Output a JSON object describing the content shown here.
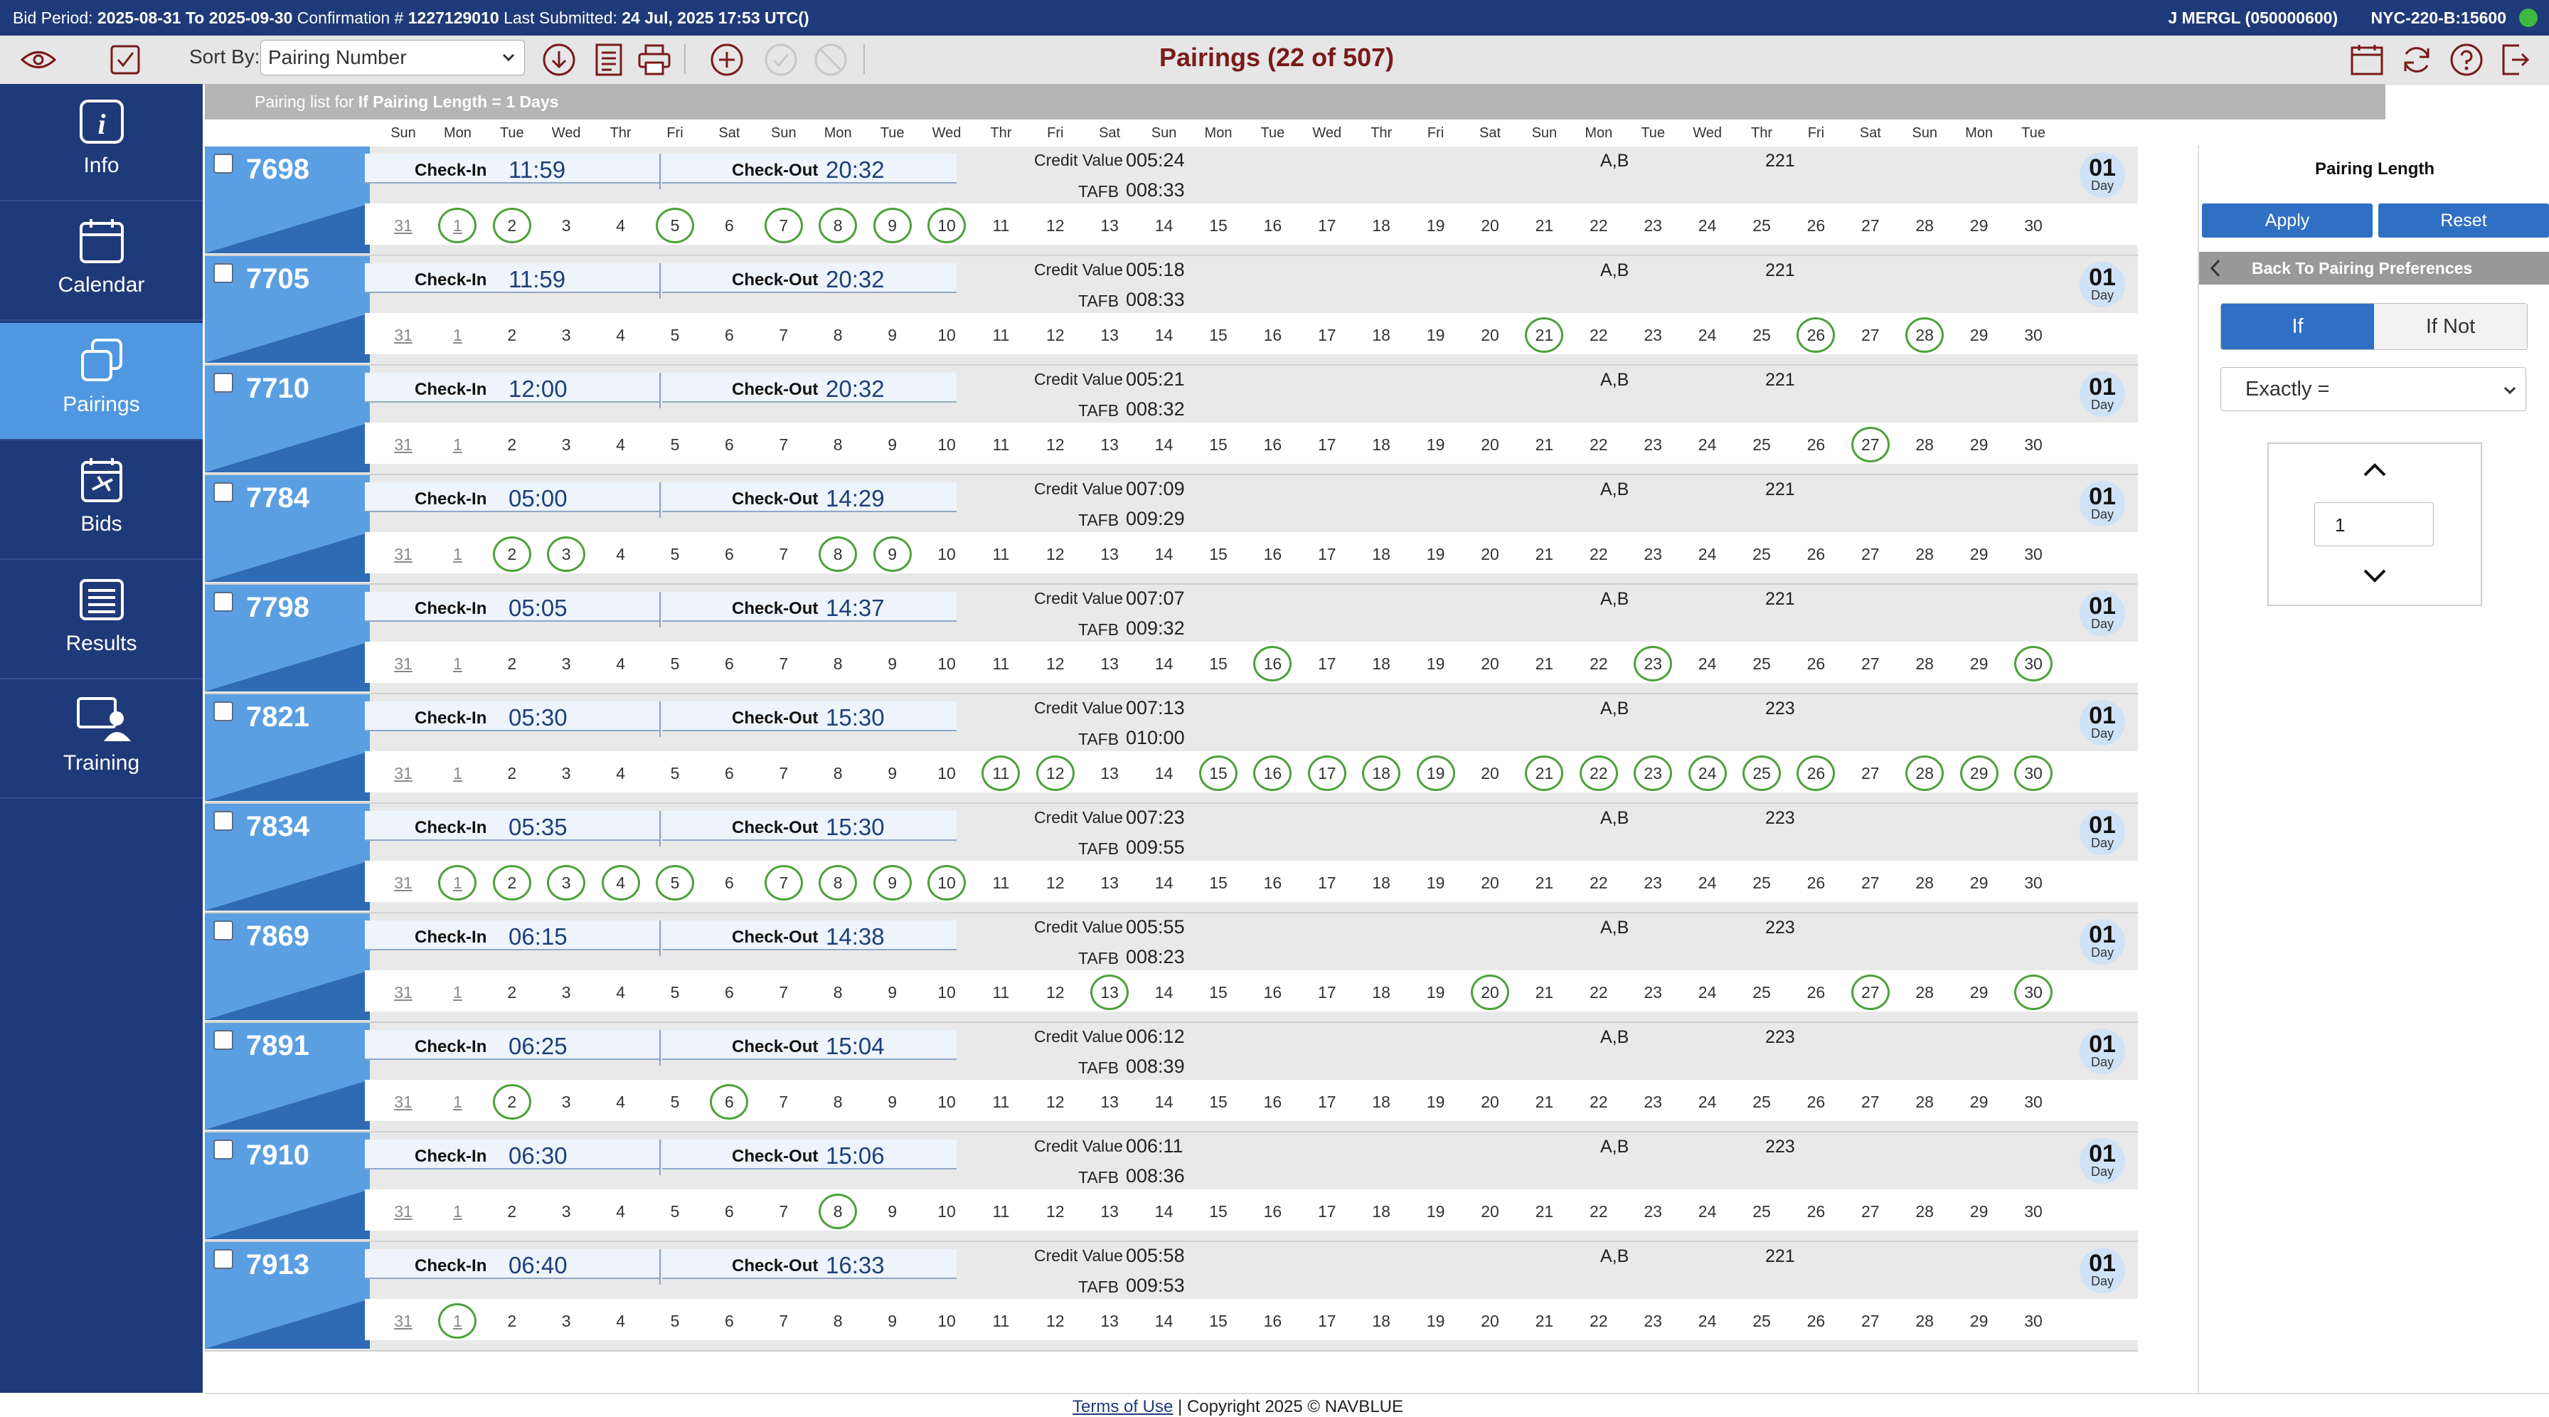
{
  "topbar": {
    "bid_period_label": "Bid Period:",
    "bid_period_value": "2025-08-31 To 2025-09-30",
    "confirmation_label": "Confirmation #",
    "confirmation_value": "1227129010",
    "last_submitted_label": "Last Submitted:",
    "last_submitted_value": "24 Jul, 2025 17:53 UTC()",
    "user": "J MERGL (050000600)",
    "bid_code": "NYC-220-B:15600",
    "status_color": "#3fb93f"
  },
  "toolbar": {
    "sort_by_label": "Sort By:",
    "sort_by_value": "Pairing Number",
    "title": "Pairings (22 of 507)",
    "left_icons": [
      "eye-icon",
      "checkbox-icon",
      "download-icon",
      "report-icon",
      "print-icon",
      "add-icon",
      "check-icon",
      "cancel-icon"
    ],
    "right_icons": [
      "calendar-icon",
      "refresh-icon",
      "help-icon",
      "logout-icon"
    ]
  },
  "sidebar": {
    "items": [
      {
        "label": "Info",
        "icon": "info-icon",
        "active": false
      },
      {
        "label": "Calendar",
        "icon": "calendar-icon",
        "active": false
      },
      {
        "label": "Pairings",
        "icon": "pairings-icon",
        "active": true
      },
      {
        "label": "Bids",
        "icon": "bids-icon",
        "active": false
      },
      {
        "label": "Results",
        "icon": "results-icon",
        "active": false
      },
      {
        "label": "Training",
        "icon": "training-icon",
        "active": false
      }
    ]
  },
  "list": {
    "header_prefix": "Pairing list for",
    "header_filter": "If Pairing Length = 1 Days",
    "day_names": [
      "Sun",
      "Mon",
      "Tue",
      "Wed",
      "Thr",
      "Fri",
      "Sat",
      "Sun",
      "Mon",
      "Tue",
      "Wed",
      "Thr",
      "Fri",
      "Sat",
      "Sun",
      "Mon",
      "Tue",
      "Wed",
      "Thr",
      "Fri",
      "Sat",
      "Sun",
      "Mon",
      "Tue",
      "Wed",
      "Thr",
      "Fri",
      "Sat",
      "Sun",
      "Mon",
      "Tue"
    ],
    "dates": [
      "31",
      "1",
      "2",
      "3",
      "4",
      "5",
      "6",
      "7",
      "8",
      "9",
      "10",
      "11",
      "12",
      "13",
      "14",
      "15",
      "16",
      "17",
      "18",
      "19",
      "20",
      "21",
      "22",
      "23",
      "24",
      "25",
      "26",
      "27",
      "28",
      "29",
      "30"
    ],
    "checkin_label": "Check-In",
    "checkout_label": "Check-Out",
    "credit_label": "Credit Value",
    "tafb_label": "TAFB",
    "day_badge_label": "Day",
    "pairings": [
      {
        "number": "7698",
        "checkin": "11:59",
        "checkout": "20:32",
        "credit": "005:24",
        "tafb": "008:33",
        "base": "A,B",
        "equipment": "221",
        "days": "01",
        "active_days": [
          1,
          2,
          5,
          7,
          8,
          9,
          10
        ]
      },
      {
        "number": "7705",
        "checkin": "11:59",
        "checkout": "20:32",
        "credit": "005:18",
        "tafb": "008:33",
        "base": "A,B",
        "equipment": "221",
        "days": "01",
        "active_days": [
          21,
          26,
          28
        ]
      },
      {
        "number": "7710",
        "checkin": "12:00",
        "checkout": "20:32",
        "credit": "005:21",
        "tafb": "008:32",
        "base": "A,B",
        "equipment": "221",
        "days": "01",
        "active_days": [
          27
        ]
      },
      {
        "number": "7784",
        "checkin": "05:00",
        "checkout": "14:29",
        "credit": "007:09",
        "tafb": "009:29",
        "base": "A,B",
        "equipment": "221",
        "days": "01",
        "active_days": [
          2,
          3,
          8,
          9
        ]
      },
      {
        "number": "7798",
        "checkin": "05:05",
        "checkout": "14:37",
        "credit": "007:07",
        "tafb": "009:32",
        "base": "A,B",
        "equipment": "221",
        "days": "01",
        "active_days": [
          16,
          23,
          30
        ]
      },
      {
        "number": "7821",
        "checkin": "05:30",
        "checkout": "15:30",
        "credit": "007:13",
        "tafb": "010:00",
        "base": "A,B",
        "equipment": "223",
        "days": "01",
        "active_days": [
          11,
          12,
          15,
          16,
          17,
          18,
          19,
          21,
          22,
          23,
          24,
          25,
          26,
          28,
          29,
          30
        ]
      },
      {
        "number": "7834",
        "checkin": "05:35",
        "checkout": "15:30",
        "credit": "007:23",
        "tafb": "009:55",
        "base": "A,B",
        "equipment": "223",
        "days": "01",
        "active_days": [
          1,
          2,
          3,
          4,
          5,
          7,
          8,
          9,
          10
        ]
      },
      {
        "number": "7869",
        "checkin": "06:15",
        "checkout": "14:38",
        "credit": "005:55",
        "tafb": "008:23",
        "base": "A,B",
        "equipment": "223",
        "days": "01",
        "active_days": [
          13,
          20,
          27,
          30
        ]
      },
      {
        "number": "7891",
        "checkin": "06:25",
        "checkout": "15:04",
        "credit": "006:12",
        "tafb": "008:39",
        "base": "A,B",
        "equipment": "223",
        "days": "01",
        "active_days": [
          2,
          6
        ]
      },
      {
        "number": "7910",
        "checkin": "06:30",
        "checkout": "15:06",
        "credit": "006:11",
        "tafb": "008:36",
        "base": "A,B",
        "equipment": "223",
        "days": "01",
        "active_days": [
          8
        ]
      },
      {
        "number": "7913",
        "checkin": "06:40",
        "checkout": "16:33",
        "credit": "005:58",
        "tafb": "009:53",
        "base": "A,B",
        "equipment": "221",
        "days": "01",
        "active_days": [
          1
        ]
      }
    ]
  },
  "filter_panel": {
    "title": "Pairing Length",
    "apply_label": "Apply",
    "reset_label": "Reset",
    "back_label": "Back To Pairing Preferences",
    "if_label": "If",
    "if_not_label": "If Not",
    "comparator": "Exactly =",
    "value": "1"
  },
  "footer": {
    "terms_label": "Terms of Use",
    "copyright": "| Copyright 2025 © NAVBLUE"
  },
  "colors": {
    "topbar": "#1f3a78",
    "accent": "#2f6fc4",
    "active_day_ring": "#4ca13a",
    "title": "#7a1a1a",
    "sidebar_active": "#4f97e0"
  }
}
